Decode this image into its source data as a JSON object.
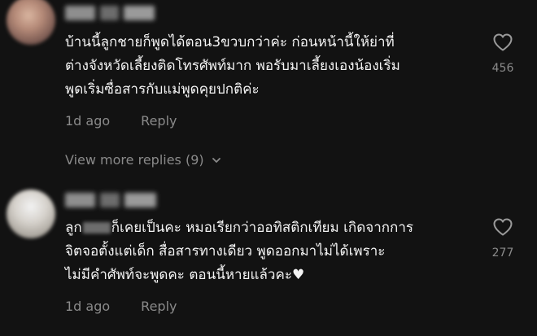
{
  "comments": [
    {
      "text": "บ้านนี้ลูกชายก็พูดได้ตอน3ขวบกว่าค่ะ ก่อนหน้านี้ให้ย่าที่\nต่างจังหวัดเลี้ยงติดโทรศัพท์มาก พอรับมาเลี้ยงเองน้องเริ่ม\nพูดเริ่มซื่อสารกับแม่พูดคุยปกติค่ะ",
      "time": "1d ago",
      "reply_label": "Reply",
      "likes": "456",
      "view_more": "View more replies (9)"
    },
    {
      "text_before": "ลูก",
      "text_after": "ก็เคยเป็นคะ หมอเรียกว่าออทิสติกเทียม เกิดจากการ\nจิตจอตั้งแต่เด็ก สื่อสารทางเดียว พูดออกมาไม่ได้เพราะ\nไม่มีคำศัพท์จะพูดคะ ตอนนี้หายแล้วคะ♥",
      "time": "1d ago",
      "reply_label": "Reply",
      "likes": "277"
    }
  ],
  "icons": {
    "like": "heart-outline-icon",
    "expand": "chevron-down-icon"
  },
  "colors": {
    "background": "#121212",
    "text": "#f4f4f4",
    "muted": "#8a8a8a"
  }
}
